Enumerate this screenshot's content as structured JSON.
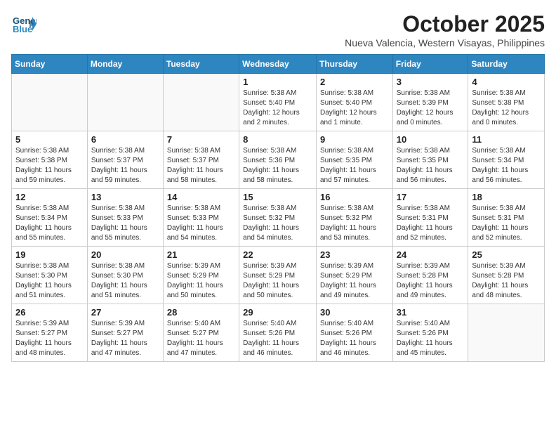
{
  "header": {
    "logo_line1": "General",
    "logo_line2": "Blue",
    "month_year": "October 2025",
    "location": "Nueva Valencia, Western Visayas, Philippines"
  },
  "days_of_week": [
    "Sunday",
    "Monday",
    "Tuesday",
    "Wednesday",
    "Thursday",
    "Friday",
    "Saturday"
  ],
  "weeks": [
    [
      {
        "day": "",
        "info": ""
      },
      {
        "day": "",
        "info": ""
      },
      {
        "day": "",
        "info": ""
      },
      {
        "day": "1",
        "info": "Sunrise: 5:38 AM\nSunset: 5:40 PM\nDaylight: 12 hours\nand 2 minutes."
      },
      {
        "day": "2",
        "info": "Sunrise: 5:38 AM\nSunset: 5:40 PM\nDaylight: 12 hours\nand 1 minute."
      },
      {
        "day": "3",
        "info": "Sunrise: 5:38 AM\nSunset: 5:39 PM\nDaylight: 12 hours\nand 0 minutes."
      },
      {
        "day": "4",
        "info": "Sunrise: 5:38 AM\nSunset: 5:38 PM\nDaylight: 12 hours\nand 0 minutes."
      }
    ],
    [
      {
        "day": "5",
        "info": "Sunrise: 5:38 AM\nSunset: 5:38 PM\nDaylight: 11 hours\nand 59 minutes."
      },
      {
        "day": "6",
        "info": "Sunrise: 5:38 AM\nSunset: 5:37 PM\nDaylight: 11 hours\nand 59 minutes."
      },
      {
        "day": "7",
        "info": "Sunrise: 5:38 AM\nSunset: 5:37 PM\nDaylight: 11 hours\nand 58 minutes."
      },
      {
        "day": "8",
        "info": "Sunrise: 5:38 AM\nSunset: 5:36 PM\nDaylight: 11 hours\nand 58 minutes."
      },
      {
        "day": "9",
        "info": "Sunrise: 5:38 AM\nSunset: 5:35 PM\nDaylight: 11 hours\nand 57 minutes."
      },
      {
        "day": "10",
        "info": "Sunrise: 5:38 AM\nSunset: 5:35 PM\nDaylight: 11 hours\nand 56 minutes."
      },
      {
        "day": "11",
        "info": "Sunrise: 5:38 AM\nSunset: 5:34 PM\nDaylight: 11 hours\nand 56 minutes."
      }
    ],
    [
      {
        "day": "12",
        "info": "Sunrise: 5:38 AM\nSunset: 5:34 PM\nDaylight: 11 hours\nand 55 minutes."
      },
      {
        "day": "13",
        "info": "Sunrise: 5:38 AM\nSunset: 5:33 PM\nDaylight: 11 hours\nand 55 minutes."
      },
      {
        "day": "14",
        "info": "Sunrise: 5:38 AM\nSunset: 5:33 PM\nDaylight: 11 hours\nand 54 minutes."
      },
      {
        "day": "15",
        "info": "Sunrise: 5:38 AM\nSunset: 5:32 PM\nDaylight: 11 hours\nand 54 minutes."
      },
      {
        "day": "16",
        "info": "Sunrise: 5:38 AM\nSunset: 5:32 PM\nDaylight: 11 hours\nand 53 minutes."
      },
      {
        "day": "17",
        "info": "Sunrise: 5:38 AM\nSunset: 5:31 PM\nDaylight: 11 hours\nand 52 minutes."
      },
      {
        "day": "18",
        "info": "Sunrise: 5:38 AM\nSunset: 5:31 PM\nDaylight: 11 hours\nand 52 minutes."
      }
    ],
    [
      {
        "day": "19",
        "info": "Sunrise: 5:38 AM\nSunset: 5:30 PM\nDaylight: 11 hours\nand 51 minutes."
      },
      {
        "day": "20",
        "info": "Sunrise: 5:38 AM\nSunset: 5:30 PM\nDaylight: 11 hours\nand 51 minutes."
      },
      {
        "day": "21",
        "info": "Sunrise: 5:39 AM\nSunset: 5:29 PM\nDaylight: 11 hours\nand 50 minutes."
      },
      {
        "day": "22",
        "info": "Sunrise: 5:39 AM\nSunset: 5:29 PM\nDaylight: 11 hours\nand 50 minutes."
      },
      {
        "day": "23",
        "info": "Sunrise: 5:39 AM\nSunset: 5:29 PM\nDaylight: 11 hours\nand 49 minutes."
      },
      {
        "day": "24",
        "info": "Sunrise: 5:39 AM\nSunset: 5:28 PM\nDaylight: 11 hours\nand 49 minutes."
      },
      {
        "day": "25",
        "info": "Sunrise: 5:39 AM\nSunset: 5:28 PM\nDaylight: 11 hours\nand 48 minutes."
      }
    ],
    [
      {
        "day": "26",
        "info": "Sunrise: 5:39 AM\nSunset: 5:27 PM\nDaylight: 11 hours\nand 48 minutes."
      },
      {
        "day": "27",
        "info": "Sunrise: 5:39 AM\nSunset: 5:27 PM\nDaylight: 11 hours\nand 47 minutes."
      },
      {
        "day": "28",
        "info": "Sunrise: 5:40 AM\nSunset: 5:27 PM\nDaylight: 11 hours\nand 47 minutes."
      },
      {
        "day": "29",
        "info": "Sunrise: 5:40 AM\nSunset: 5:26 PM\nDaylight: 11 hours\nand 46 minutes."
      },
      {
        "day": "30",
        "info": "Sunrise: 5:40 AM\nSunset: 5:26 PM\nDaylight: 11 hours\nand 46 minutes."
      },
      {
        "day": "31",
        "info": "Sunrise: 5:40 AM\nSunset: 5:26 PM\nDaylight: 11 hours\nand 45 minutes."
      },
      {
        "day": "",
        "info": ""
      }
    ]
  ]
}
